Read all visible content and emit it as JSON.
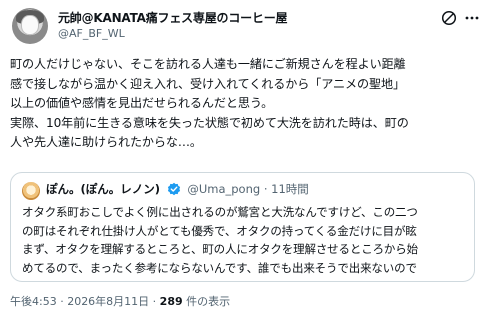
{
  "author": {
    "display_name": "元帥@KANATA痛フェス専屋のコーヒー屋",
    "handle": "@AF_BF_WL"
  },
  "icons": {
    "edit": "edit-slash-icon",
    "more": "more-horizontal-icon",
    "verified": "verified-badge-icon"
  },
  "colors": {
    "verified_blue": "#1d9bf0",
    "secondary_text": "#536471",
    "border": "#cfd9de"
  },
  "body_lines": [
    "町の人だけじゃない、そこを訪れる人達も一緒にご新規さんを程よい距離",
    "感で接しながら温かく迎え入れ、受け入れてくれるから「アニメの聖地」",
    "以上の価値や感情を見出だせられるんだと思う。",
    "実際、10年前に生きる意味を失った状態で初めて大洗を訪れた時は、町の",
    "人や先人達に助けられたからな…。"
  ],
  "quote": {
    "display_name": "ぽん。(ぽん。レノン)",
    "handle": "@Uma_pong",
    "separator": "·",
    "time": "11時間",
    "lines": [
      "オタク系町おこしでよく例に出されるのが鷲宮と大洗なんですけど、この二つ",
      "の町はそれぞれ仕掛け人がとても優秀で、オタクの持ってくる金だけに目が眩",
      "まず、オタクを理解するところと、町の人にオタクを理解させるところから始",
      "めてるので、まったく参考にならないんです、誰でも出来そうで出来ないので"
    ]
  },
  "meta": {
    "timestamp": "午後4:53 · 2026年8月11日 · ",
    "views_count": "289",
    "views_label": " 件の表示"
  }
}
